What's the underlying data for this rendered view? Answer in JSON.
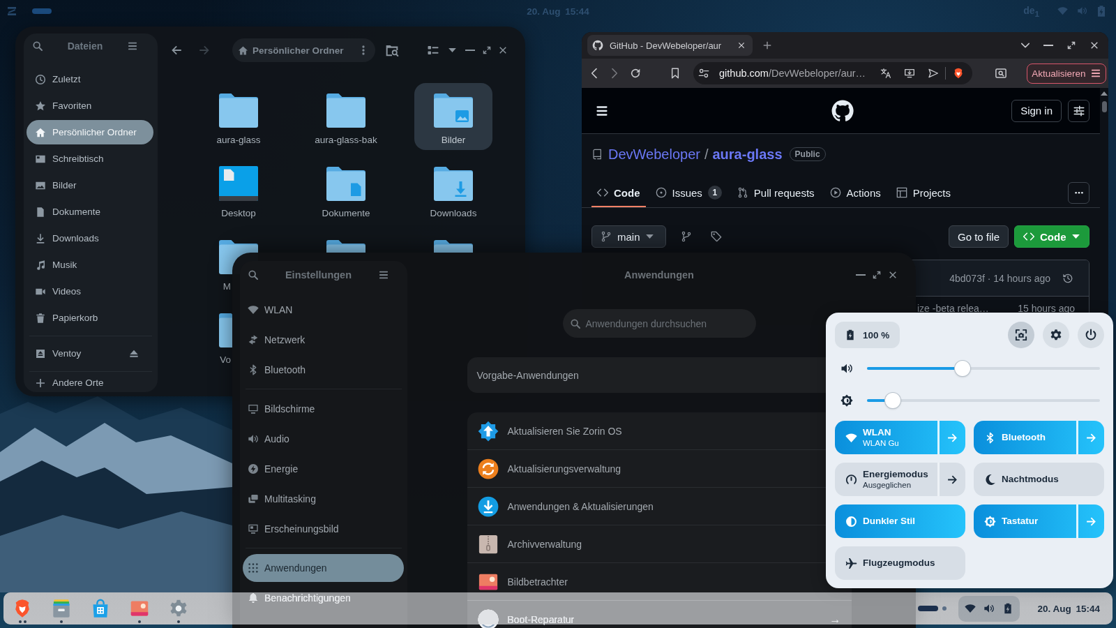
{
  "top_bar": {
    "clock": "20. Aug 15:44",
    "keyboard_layout": "de$_{1}$"
  },
  "file_manager": {
    "sidebar_title": "Dateien",
    "places": [
      {
        "label": "Zuletzt",
        "selected": false
      },
      {
        "label": "Favoriten",
        "selected": false
      },
      {
        "label": "Persönlicher Ordner",
        "selected": true
      },
      {
        "label": "Schreibtisch",
        "selected": false
      },
      {
        "label": "Bilder",
        "selected": false
      },
      {
        "label": "Dokumente",
        "selected": false
      },
      {
        "label": "Downloads",
        "selected": false
      },
      {
        "label": "Musik",
        "selected": false
      },
      {
        "label": "Videos",
        "selected": false
      },
      {
        "label": "Papierkorb",
        "selected": false
      }
    ],
    "devices": [
      {
        "label": "Ventoy",
        "selected": false
      }
    ],
    "other_locations": "Andere Orte",
    "path": "Persönlicher Ordner",
    "items": [
      {
        "kind": "folder",
        "label": "aura-glass",
        "selected": false,
        "cut": false
      },
      {
        "kind": "folder",
        "label": "aura-glass-bak",
        "selected": false,
        "cut": false
      },
      {
        "kind": "pictures",
        "label": "Bilder",
        "selected": true,
        "cut": false
      },
      {
        "kind": "desktop",
        "label": "Desktop",
        "selected": false,
        "cut": false
      },
      {
        "kind": "documents",
        "label": "Dokumente",
        "selected": false,
        "cut": false
      },
      {
        "kind": "downloads",
        "label": "Downloads",
        "selected": false,
        "cut": false
      },
      {
        "kind": "folder",
        "label": "M",
        "selected": false,
        "cut": true
      },
      {
        "kind": "folder",
        "selected": false
      },
      {
        "kind": "folder",
        "selected": false
      },
      {
        "kind": "folder",
        "label": "Vo",
        "selected": false,
        "cut": true
      }
    ]
  },
  "browser": {
    "tab_title": "GitHub - DevWebeloper/aur",
    "url_host": "github.com",
    "url_path": "/DevWebeloper/aur…",
    "update_button": "Aktualisieren",
    "page": {
      "sign_in": "Sign in",
      "owner": "DevWebeloper",
      "separator": "/",
      "repo": "aura-glass",
      "visibility": "Public",
      "tabs": [
        {
          "label": "Code",
          "selected": true
        },
        {
          "label": "Issues",
          "count": "1",
          "selected": false
        },
        {
          "label": "Pull requests",
          "selected": false
        },
        {
          "label": "Actions",
          "selected": false
        },
        {
          "label": "Projects",
          "selected": false
        }
      ],
      "branch": "main",
      "go_to_file": "Go to file",
      "code_button": "Code",
      "latest_commit": "4bd073f · 14 hours ago",
      "rows": [
        {
          "message": "ize -beta relea…",
          "time": "15 hours ago"
        }
      ]
    }
  },
  "settings": {
    "sidebar_title": "Einstellungen",
    "groups": [
      {
        "items": [
          {
            "label": "WLAN",
            "selected": false
          },
          {
            "label": "Netzwerk",
            "selected": false
          },
          {
            "label": "Bluetooth",
            "selected": false
          }
        ]
      },
      {
        "items": [
          {
            "label": "Bildschirme",
            "selected": false
          },
          {
            "label": "Audio",
            "selected": false
          },
          {
            "label": "Energie",
            "selected": false
          },
          {
            "label": "Multitasking",
            "selected": false
          },
          {
            "label": "Erscheinungsbild",
            "selected": false
          }
        ]
      },
      {
        "items": [
          {
            "label": "Anwendungen",
            "selected": true
          },
          {
            "label": "Benachrichtigungen",
            "selected": false
          }
        ]
      }
    ],
    "page_title": "Anwendungen",
    "search": {
      "placeholder": "Anwendungen durchsuchen"
    },
    "default_apps": "Vorgabe-Anwendungen",
    "apps": [
      {
        "name": "Aktualisieren Sie Zorin OS"
      },
      {
        "name": "Aktualisierungsverwaltung"
      },
      {
        "name": "Anwendungen & Aktualisierungen"
      },
      {
        "name": "Archivverwaltung"
      },
      {
        "name": "Bildbetrachter"
      },
      {
        "name": "Boot-Reparatur",
        "arrow": "→"
      }
    ]
  },
  "quick_settings": {
    "battery": "100 %",
    "sliders": [
      {
        "kind": "volume",
        "level": 0.41
      },
      {
        "kind": "brightness",
        "level": 0.11
      }
    ],
    "tiles": [
      {
        "title": "WLAN",
        "subtitle": "WLAN Gu",
        "on": true,
        "menu": true
      },
      {
        "title": "Bluetooth",
        "on": true,
        "menu": true
      },
      {
        "title": "Energiemodus",
        "subtitle": "Ausgeglichen",
        "on": false,
        "menu": true
      },
      {
        "title": "Nachtmodus",
        "on": false,
        "menu": false
      },
      {
        "title": "Dunkler Stil",
        "on": true,
        "menu": false
      },
      {
        "title": "Tastatur",
        "on": true,
        "menu": true
      },
      {
        "title": "Flugzeugmodus",
        "on": false,
        "menu": false
      }
    ]
  },
  "taskbar": {
    "apps": [
      {
        "running": true,
        "multi_window": true
      },
      {
        "running": true,
        "multi_window": false
      },
      {
        "running": false,
        "multi_window": false
      },
      {
        "running": true,
        "multi_window": false
      },
      {
        "running": true,
        "multi_window": false
      }
    ],
    "clock": "20. Aug 15:44"
  }
}
